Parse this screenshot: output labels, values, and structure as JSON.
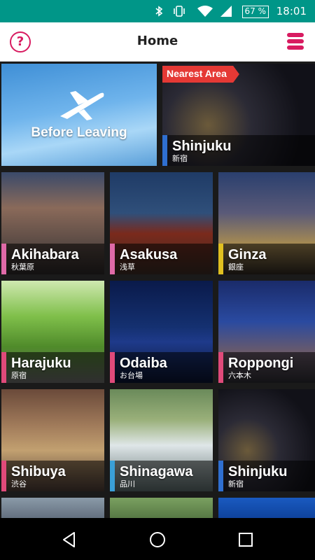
{
  "status_bar": {
    "time": "18:01",
    "battery": "67 %",
    "bg_color": "#009688"
  },
  "app_bar": {
    "title": "Home",
    "help_icon": "?",
    "accent_color": "#d81b60"
  },
  "tiles": {
    "before_leaving": {
      "label": "Before Leaving",
      "icon": "airplane-icon"
    },
    "nearest": {
      "badge": "Nearest Area",
      "name": "Shinjuku",
      "jp": "新宿",
      "bar_color": "#2f6fd0"
    },
    "akihabara": {
      "name": "Akihabara",
      "jp": "秋葉原",
      "bar_color": "#e06aa8"
    },
    "asakusa": {
      "name": "Asakusa",
      "jp": "浅草",
      "bar_color": "#e06aa8"
    },
    "ginza": {
      "name": "Ginza",
      "jp": "銀座",
      "bar_color": "#e0c020"
    },
    "harajuku": {
      "name": "Harajuku",
      "jp": "原宿",
      "bar_color": "#e04a7a"
    },
    "odaiba": {
      "name": "Odaiba",
      "jp": "お台場",
      "bar_color": "#e04a7a"
    },
    "roppongi": {
      "name": "Roppongi",
      "jp": "六本木",
      "bar_color": "#e04a7a"
    },
    "shibuya": {
      "name": "Shibuya",
      "jp": "渋谷",
      "bar_color": "#e04a7a"
    },
    "shinagawa": {
      "name": "Shinagawa",
      "jp": "品川",
      "bar_color": "#3aa0d8"
    },
    "shinjuku": {
      "name": "Shinjuku",
      "jp": "新宿",
      "bar_color": "#2f6fd0"
    }
  },
  "nav_bar": {
    "back": "back-icon",
    "home": "home-icon",
    "recents": "recents-icon"
  }
}
